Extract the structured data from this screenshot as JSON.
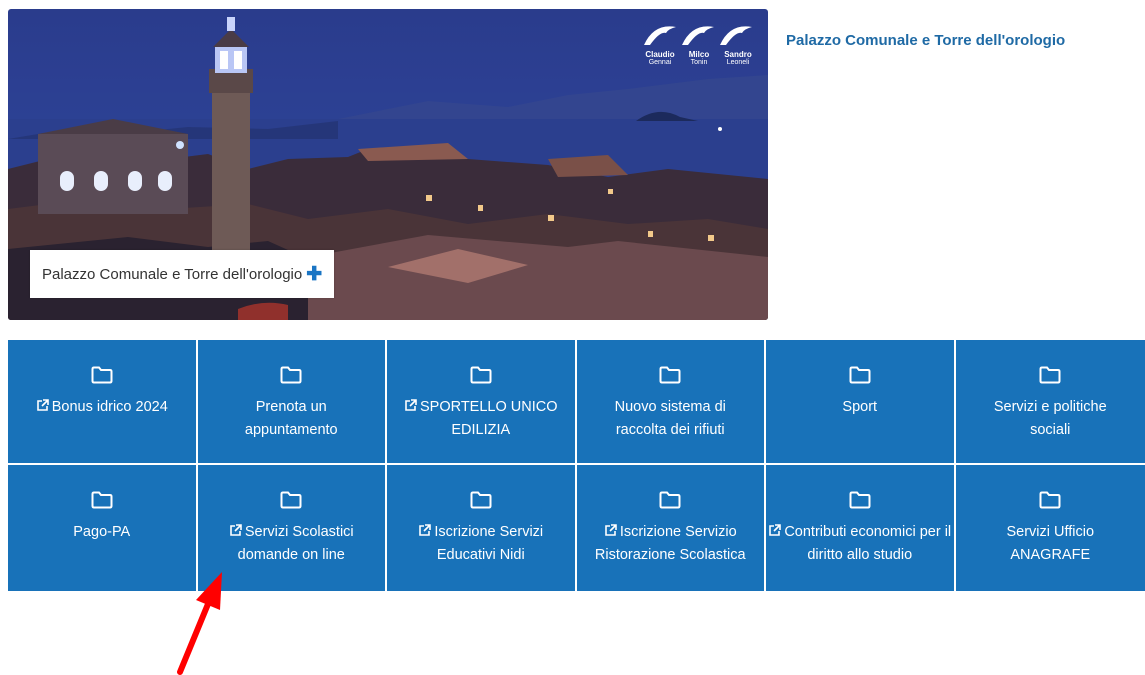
{
  "hero": {
    "caption": "Palazzo Comunale e Torre dell'orologio",
    "caption_icon": "plus-icon",
    "logo": {
      "names": [
        {
          "first": "Claudio",
          "last": "Gennai"
        },
        {
          "first": "Milco",
          "last": "Tonin"
        },
        {
          "first": "Sandro",
          "last": "Leoneli"
        }
      ]
    }
  },
  "side": {
    "title": "Palazzo Comunale e Torre dell'orologio"
  },
  "colors": {
    "tile_bg": "#1872b9",
    "accent": "#1a75c4",
    "title": "#1f6aa5",
    "annotation_arrow": "#ff0000"
  },
  "tiles": [
    {
      "label": "Bonus idrico 2024",
      "external": true
    },
    {
      "label": "Prenota un appuntamento",
      "external": false
    },
    {
      "label": "SPORTELLO UNICO EDILIZIA",
      "external": true
    },
    {
      "label": "Nuovo sistema di raccolta dei rifiuti",
      "external": false
    },
    {
      "label": "Sport",
      "external": false
    },
    {
      "label": "Servizi e politiche sociali",
      "external": false
    },
    {
      "label": "Pago-PA",
      "external": false
    },
    {
      "label": "Servizi Scolastici domande on line",
      "external": true
    },
    {
      "label": "Iscrizione Servizi Educativi Nidi",
      "external": true
    },
    {
      "label": "Iscrizione Servizio Ristorazione Scolastica",
      "external": true
    },
    {
      "label": "Contributi economici per il diritto allo studio",
      "external": true
    },
    {
      "label": "Servizi Ufficio ANAGRAFE",
      "external": false
    }
  ]
}
